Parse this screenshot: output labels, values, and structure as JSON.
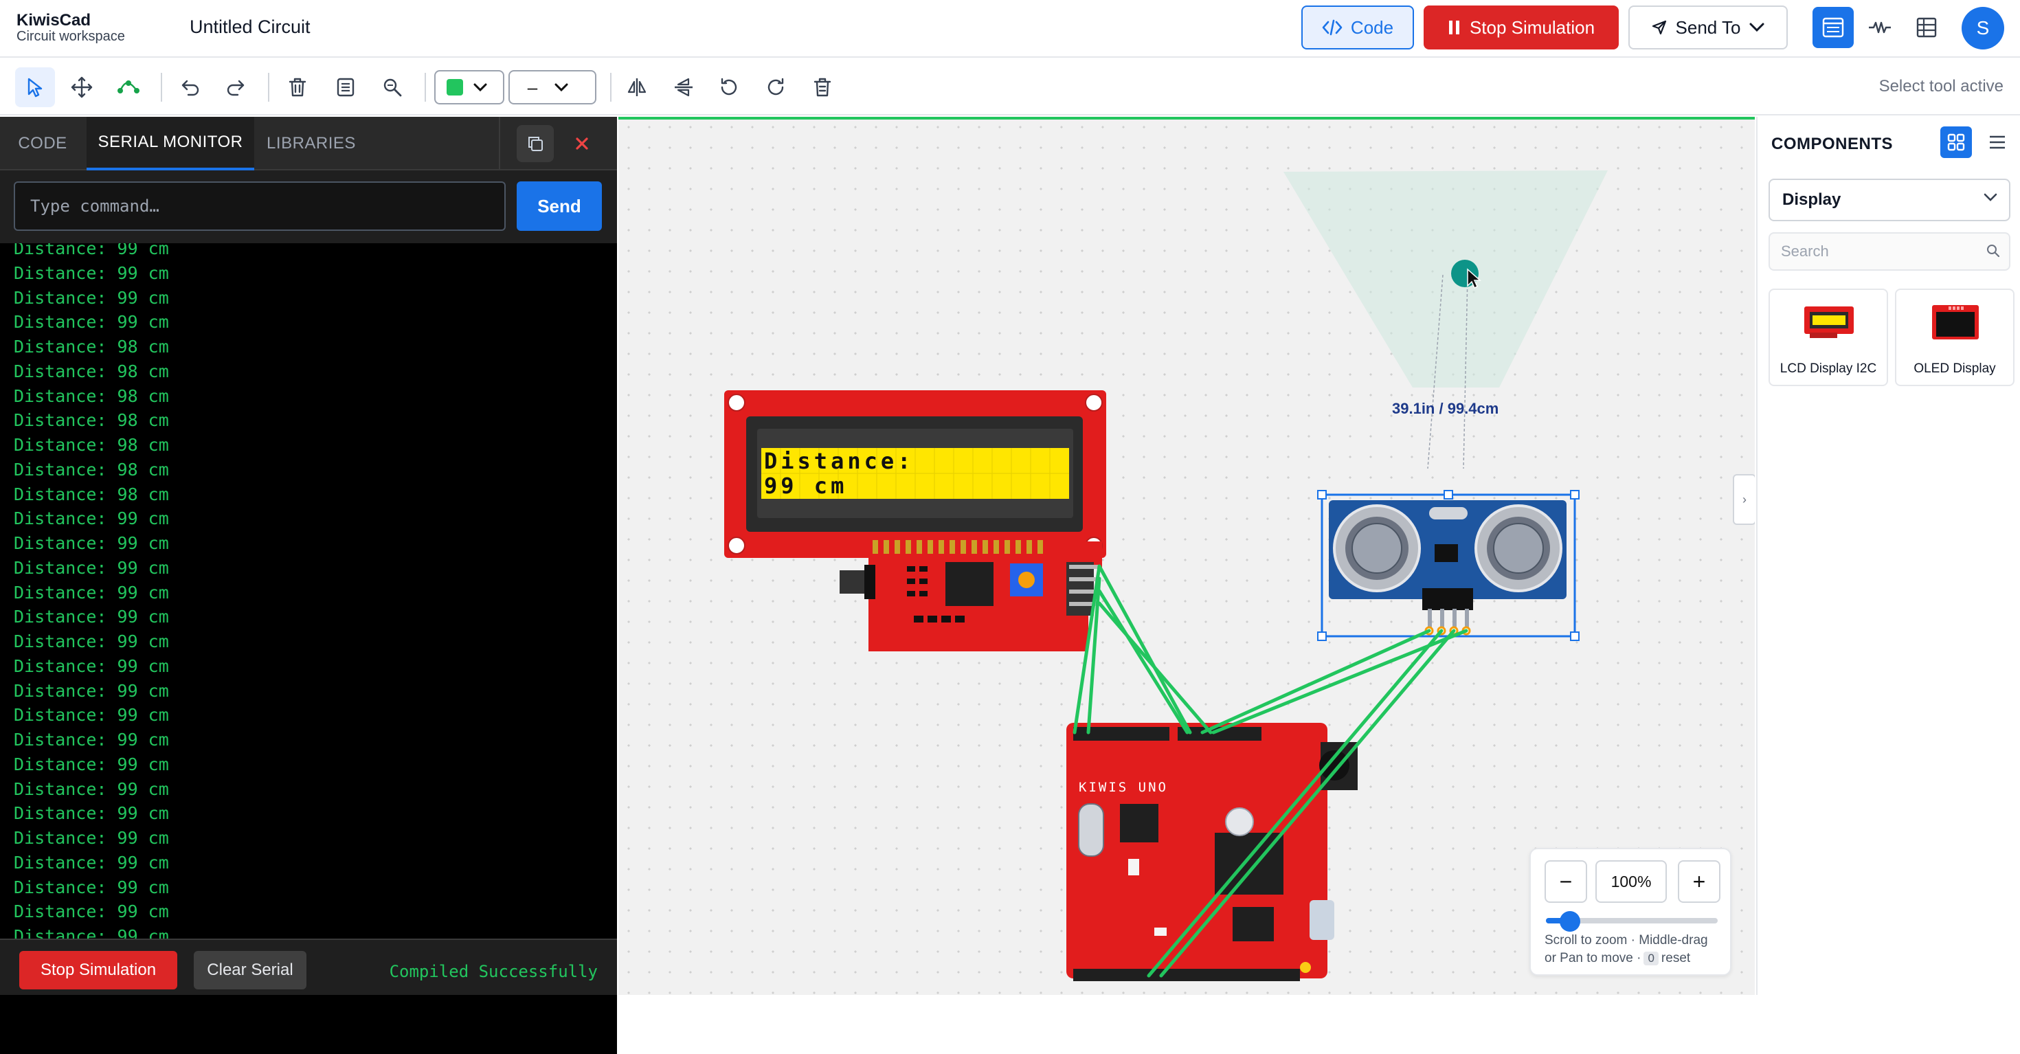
{
  "header": {
    "brand_name": "KiwisCad",
    "brand_sub": "Circuit workspace",
    "circuit_title": "Untitled Circuit",
    "code_label": "Code",
    "stop_label": "Stop Simulation",
    "send_to_label": "Send To",
    "avatar_initial": "S"
  },
  "toolbar": {
    "line_style": "–",
    "wire_color": "#22c55e",
    "status": "Select tool active"
  },
  "left_panel": {
    "tabs": [
      "CODE",
      "SERIAL MONITOR",
      "LIBRARIES"
    ],
    "active_tab": "SERIAL MONITOR",
    "command_placeholder": "Type command…",
    "send_label": "Send",
    "serial_lines": [
      "Distance: 99 cm",
      "Distance: 99 cm",
      "Distance: 99 cm",
      "Distance: 99 cm",
      "Distance: 98 cm",
      "Distance: 98 cm",
      "Distance: 98 cm",
      "Distance: 98 cm",
      "Distance: 98 cm",
      "Distance: 98 cm",
      "Distance: 98 cm",
      "Distance: 99 cm",
      "Distance: 99 cm",
      "Distance: 99 cm",
      "Distance: 99 cm",
      "Distance: 99 cm",
      "Distance: 99 cm",
      "Distance: 99 cm",
      "Distance: 99 cm",
      "Distance: 99 cm",
      "Distance: 99 cm",
      "Distance: 99 cm",
      "Distance: 99 cm",
      "Distance: 99 cm",
      "Distance: 99 cm",
      "Distance: 99 cm",
      "Distance: 99 cm",
      "Distance: 99 cm",
      "Distance: 99 cm",
      "Distance: 99 cm"
    ],
    "stop_label": "Stop Simulation",
    "clear_label": "Clear Serial",
    "compile_status": "Compiled Successfully"
  },
  "canvas": {
    "lcd_line1": "Distance:",
    "lcd_line2": "99 cm",
    "arduino_label": "KIWIS UNO",
    "distance_readout": "39.1in / 99.4cm",
    "collapse_glyph": "›"
  },
  "zoom": {
    "level": "100%",
    "level_fraction": 0.14,
    "minus": "−",
    "plus": "+",
    "help_line1": "Scroll to zoom · Middle-drag",
    "help_line2a": "or Pan to move ·",
    "help_key": "0",
    "help_line2b": "reset"
  },
  "right_panel": {
    "title": "COMPONENTS",
    "category": "Display",
    "search_placeholder": "Search",
    "components": [
      {
        "name": "LCD Display I2C"
      },
      {
        "name": "OLED Display"
      }
    ]
  },
  "colors": {
    "accent": "#1a73e8",
    "danger": "#dc2626",
    "serial_text": "#22c55e",
    "wire": "#22c55e"
  }
}
